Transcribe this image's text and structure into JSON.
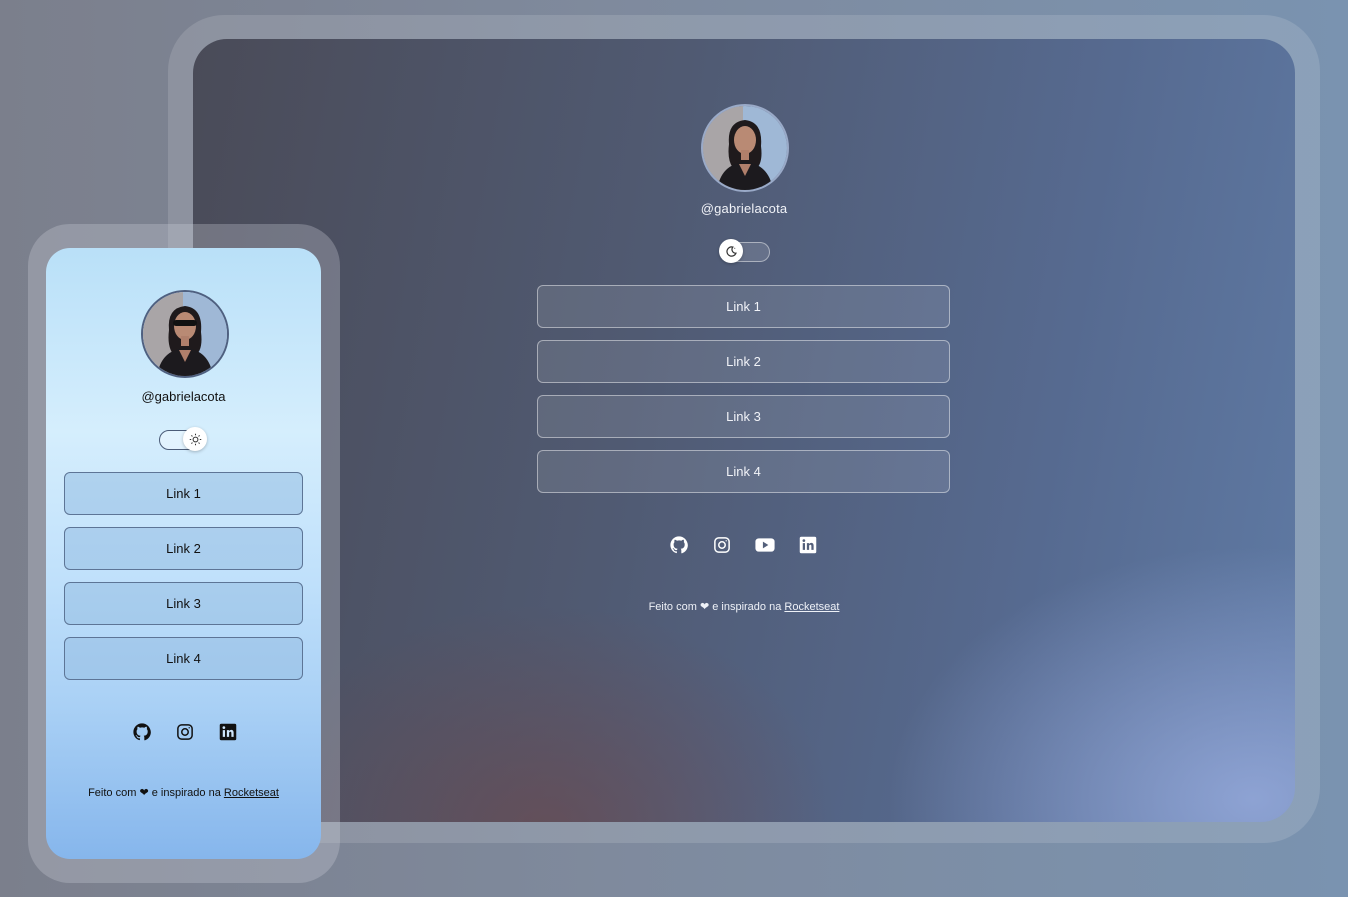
{
  "colors": {
    "desktop_text": "#f1f3f8",
    "mobile_text": "#111111",
    "desktop_link_border": "rgba(255,255,255,0.45)",
    "mobile_link_border": "#5d7596"
  },
  "desktop": {
    "username": "@gabrielacota",
    "theme_toggle": {
      "state": "dark",
      "icon": "moon-icon"
    },
    "links": [
      "Link 1",
      "Link 2",
      "Link 3",
      "Link 4"
    ],
    "social": [
      "github-icon",
      "instagram-icon",
      "youtube-icon",
      "linkedin-icon"
    ],
    "footer": {
      "prefix": "Feito com",
      "heart": "❤",
      "middle": "e inspirado na",
      "link": "Rocketseat"
    }
  },
  "mobile": {
    "username": "@gabrielacota",
    "theme_toggle": {
      "state": "light",
      "icon": "sun-icon"
    },
    "links": [
      "Link 1",
      "Link 2",
      "Link 3",
      "Link 4"
    ],
    "social": [
      "github-icon",
      "instagram-icon",
      "linkedin-icon"
    ],
    "footer": {
      "prefix": "Feito com",
      "heart": "❤",
      "middle": "e inspirado na",
      "link": "Rocketseat"
    }
  }
}
